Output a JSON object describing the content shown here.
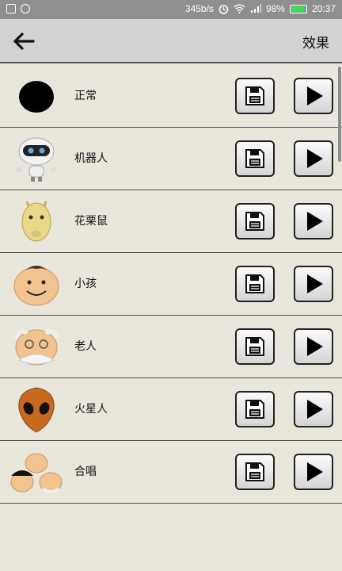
{
  "status_bar": {
    "net_speed": "345b/s",
    "battery_pct": "98%",
    "time": "20:37",
    "icons": [
      "image-icon",
      "chat-icon",
      "alarm-icon",
      "wifi-icon",
      "signal-icon",
      "battery-icon"
    ]
  },
  "app_bar": {
    "back_icon": "back-arrow-icon",
    "title": "效果"
  },
  "effects": [
    {
      "name": "正常",
      "avatar": "black-circle"
    },
    {
      "name": "机器人",
      "avatar": "robot"
    },
    {
      "name": "花栗鼠",
      "avatar": "chipmunk"
    },
    {
      "name": "小孩",
      "avatar": "child-face"
    },
    {
      "name": "老人",
      "avatar": "old-man-face"
    },
    {
      "name": "火星人",
      "avatar": "alien-face"
    },
    {
      "name": "合唱",
      "avatar": "chorus-group"
    }
  ],
  "row_actions": {
    "save_icon": "floppy-disk-icon",
    "play_icon": "play-icon"
  },
  "colors": {
    "background": "#e9e6dc",
    "app_bar": "#d2d2d2",
    "status_bar": "#8f8f8f",
    "battery": "#3ddc5c"
  }
}
